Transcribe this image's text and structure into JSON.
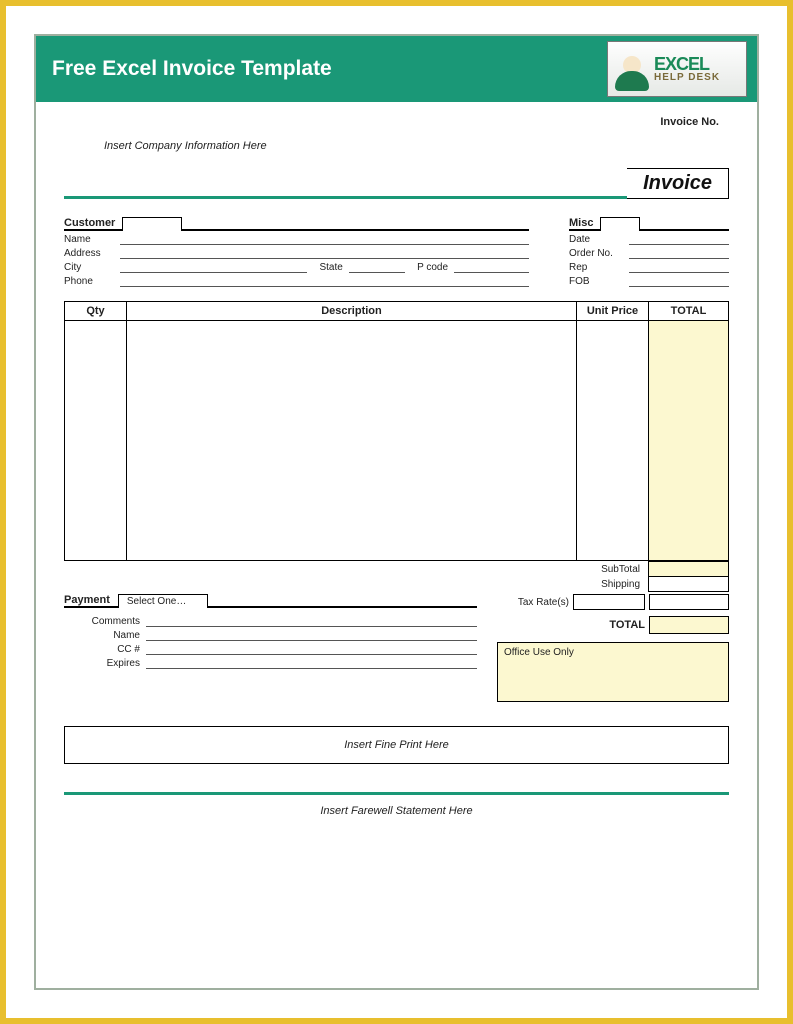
{
  "banner": {
    "title": "Free Excel Invoice Template",
    "logo_word": "EXCEL",
    "logo_sub": "HELP DESK"
  },
  "header": {
    "invoice_no_label": "Invoice No.",
    "company_placeholder": "Insert Company Information Here",
    "heading": "Invoice"
  },
  "customer": {
    "section": "Customer",
    "name": "Name",
    "address": "Address",
    "city": "City",
    "state": "State",
    "pcode": "P code",
    "phone": "Phone"
  },
  "misc": {
    "section": "Misc",
    "date": "Date",
    "order_no": "Order No.",
    "rep": "Rep",
    "fob": "FOB"
  },
  "items": {
    "qty": "Qty",
    "description": "Description",
    "unit_price": "Unit Price",
    "total": "TOTAL"
  },
  "totals": {
    "subtotal": "SubTotal",
    "shipping": "Shipping",
    "tax_rate": "Tax Rate(s)",
    "total": "TOTAL"
  },
  "payment": {
    "section": "Payment",
    "select_placeholder": "Select One…",
    "comments": "Comments",
    "name": "Name",
    "cc": "CC #",
    "expires": "Expires"
  },
  "office": {
    "label": "Office Use Only"
  },
  "fineprint": "Insert Fine Print Here",
  "farewell": "Insert Farewell Statement Here"
}
